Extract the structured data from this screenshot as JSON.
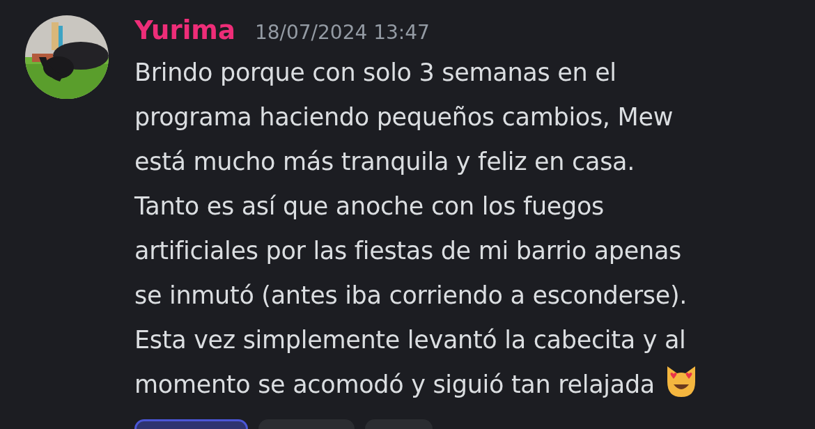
{
  "message": {
    "author": "Yurima",
    "timestamp": "18/07/2024 13:47",
    "lines": [
      "Brindo porque con solo 3 semanas en el",
      "programa haciendo pequeños cambios, Mew",
      "está mucho más tranquila y feliz en casa.",
      "Tanto es así que anoche con los fuegos",
      "artificiales por las fiestas de mi barrio apenas",
      "se inmutó (antes iba corriendo a esconderse).",
      "Esta vez simplemente levantó la cabecita y al",
      "momento se acomodó y siguió tan relajada"
    ]
  },
  "reactions": [
    {
      "selected": true
    },
    {
      "selected": false
    },
    {
      "selected": false
    }
  ]
}
